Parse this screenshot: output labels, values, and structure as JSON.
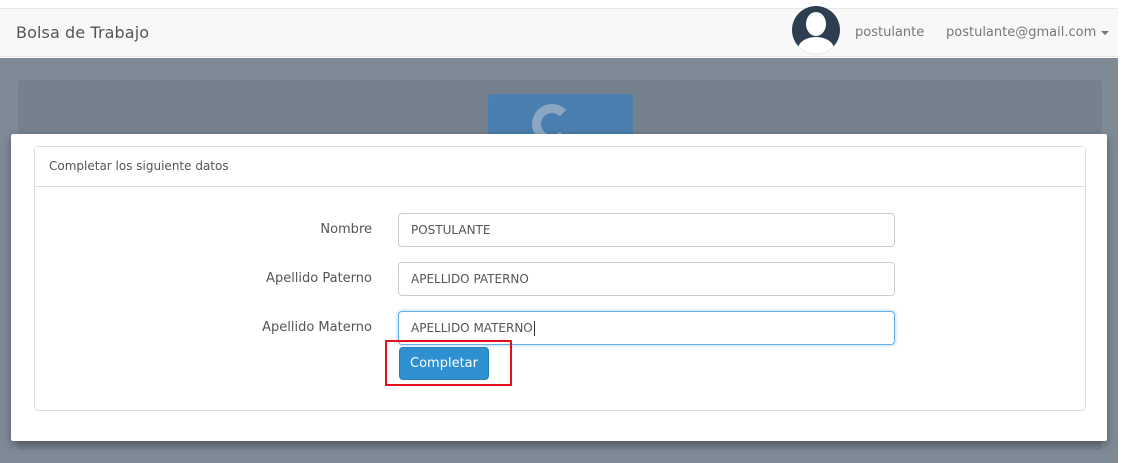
{
  "navbar": {
    "brand": "Bolsa de Trabajo",
    "username": "postulante",
    "email": "postulante@gmail.com"
  },
  "modal": {
    "heading": "Completar los siguiente datos",
    "fields": [
      {
        "label": "Nombre",
        "value": "POSTULANTE"
      },
      {
        "label": "Apellido Paterno",
        "value": "APELLIDO PATERNO"
      },
      {
        "label": "Apellido Materno",
        "value": "APELLIDO MATERNO"
      }
    ],
    "submit_label": "Completar"
  },
  "colors": {
    "primary_button": "#2e8fd1",
    "highlight": "#e3101a",
    "overlay": "#7e8a96"
  }
}
